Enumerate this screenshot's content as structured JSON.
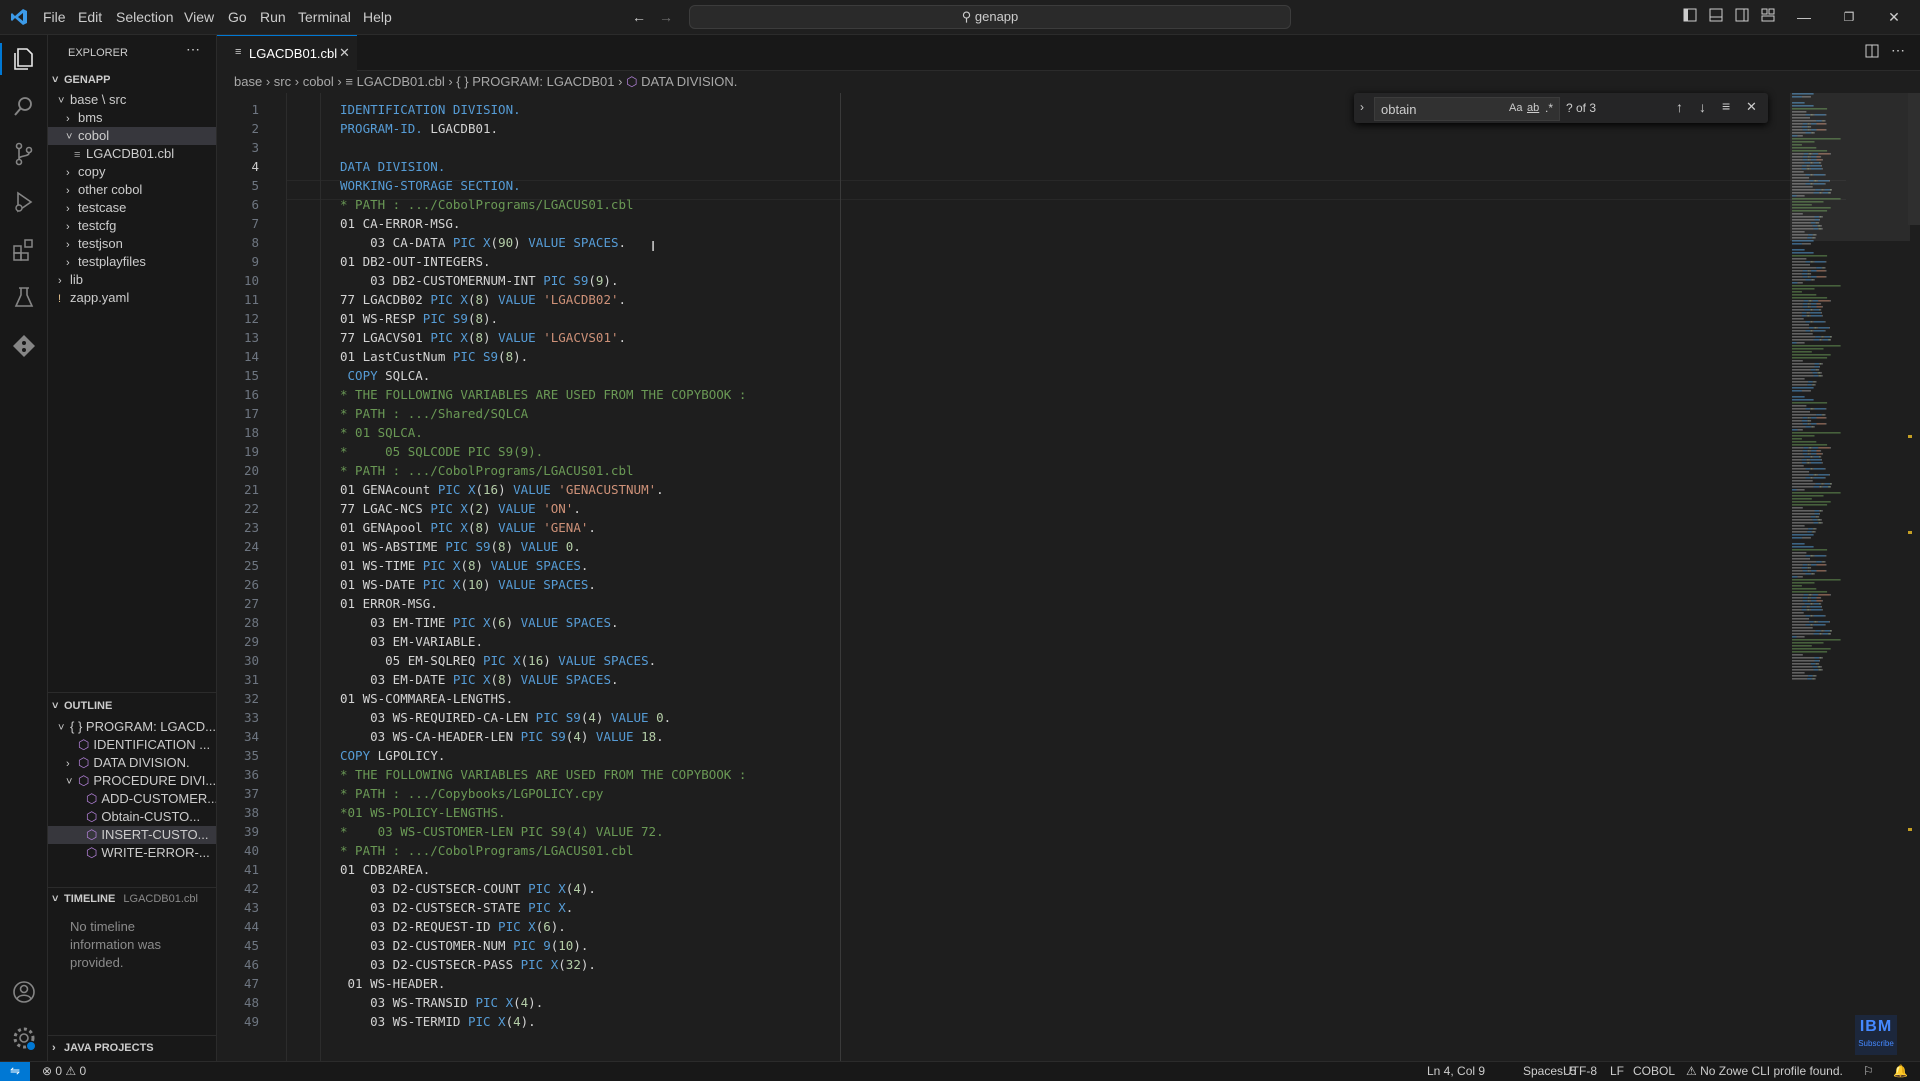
{
  "menu": [
    "File",
    "Edit",
    "Selection",
    "View",
    "Go",
    "Run",
    "Terminal",
    "Help"
  ],
  "command_center": "genapp",
  "sidebar": {
    "title": "EXPLORER",
    "root": "GENAPP",
    "tree": [
      {
        "label": "base \\ src",
        "indent": 1,
        "chev": "v"
      },
      {
        "label": "bms",
        "indent": 2,
        "chev": ">"
      },
      {
        "label": "cobol",
        "indent": 2,
        "chev": "v",
        "selected": true
      },
      {
        "label": "LGACDB01.cbl",
        "indent": 3,
        "chev": "",
        "icon": "file"
      },
      {
        "label": "copy",
        "indent": 2,
        "chev": ">"
      },
      {
        "label": "other cobol",
        "indent": 2,
        "chev": ">"
      },
      {
        "label": "testcase",
        "indent": 2,
        "chev": ">"
      },
      {
        "label": "testcfg",
        "indent": 2,
        "chev": ">"
      },
      {
        "label": "testjson",
        "indent": 2,
        "chev": ">"
      },
      {
        "label": "testplayfiles",
        "indent": 2,
        "chev": ">"
      },
      {
        "label": "lib",
        "indent": 1,
        "chev": ">"
      },
      {
        "label": "zapp.yaml",
        "indent": 1,
        "chev": "!",
        "icon": "yaml"
      }
    ],
    "outline": {
      "title": "OUTLINE",
      "items": [
        {
          "label": "{ } PROGRAM: LGACD...",
          "indent": 1,
          "chev": "v"
        },
        {
          "label": "IDENTIFICATION ...",
          "indent": 2,
          "chev": ""
        },
        {
          "label": "DATA DIVISION.",
          "indent": 2,
          "chev": ">"
        },
        {
          "label": "PROCEDURE DIVI...",
          "indent": 2,
          "chev": "v"
        },
        {
          "label": "ADD-CUSTOMER...",
          "indent": 3,
          "chev": ""
        },
        {
          "label": "Obtain-CUSTO...",
          "indent": 3,
          "chev": ""
        },
        {
          "label": "INSERT-CUSTO...",
          "indent": 3,
          "chev": "",
          "selected": true
        },
        {
          "label": "WRITE-ERROR-...",
          "indent": 3,
          "chev": ""
        }
      ]
    },
    "timeline": {
      "title": "TIMELINE",
      "file": "LGACDB01.cbl",
      "message": "No timeline information was provided."
    },
    "java_projects": "JAVA PROJECTS"
  },
  "tab": {
    "label": "LGACDB01.cbl"
  },
  "breadcrumb": [
    "base",
    "src",
    "cobol",
    "LGACDB01.cbl",
    "{ } PROGRAM: LGACDB01",
    "DATA DIVISION."
  ],
  "find": {
    "value": "obtain",
    "count": "? of 3",
    "match_case": "Aa",
    "whole_word": "ab",
    "regex": ".*"
  },
  "editor": {
    "current_line": 4,
    "lines": [
      [
        [
          "kw",
          "IDENTIFICATION DIVISION."
        ]
      ],
      [
        [
          "kw",
          "PROGRAM-ID."
        ],
        [
          "pl",
          " LGACDB01."
        ]
      ],
      [],
      [
        [
          "kw",
          "DATA DIVISION."
        ]
      ],
      [
        [
          "kw",
          "WORKING-STORAGE SECTION."
        ]
      ],
      [
        [
          "cm",
          "* PATH : .../CobolPrograms/LGACUS01.cbl"
        ]
      ],
      [
        [
          "pl",
          "01 CA-ERROR-MSG."
        ]
      ],
      [
        [
          "pl",
          "    03 CA-DATA "
        ],
        [
          "kw",
          "PIC X"
        ],
        [
          "pl",
          "("
        ],
        [
          "nm",
          "90"
        ],
        [
          "pl",
          ") "
        ],
        [
          "kw",
          "VALUE SPACES"
        ],
        [
          "pl",
          "."
        ]
      ],
      [
        [
          "pl",
          "01 DB2-OUT-INTEGERS."
        ]
      ],
      [
        [
          "pl",
          "    03 DB2-CUSTOMERNUM-INT "
        ],
        [
          "kw",
          "PIC S9"
        ],
        [
          "pl",
          "("
        ],
        [
          "nm",
          "9"
        ],
        [
          "pl",
          ")."
        ]
      ],
      [
        [
          "pl",
          "77 LGACDB02 "
        ],
        [
          "kw",
          "PIC X"
        ],
        [
          "pl",
          "("
        ],
        [
          "nm",
          "8"
        ],
        [
          "pl",
          ") "
        ],
        [
          "kw",
          "VALUE "
        ],
        [
          "st",
          "'LGACDB02'"
        ],
        [
          "pl",
          "."
        ]
      ],
      [
        [
          "pl",
          "01 WS-RESP "
        ],
        [
          "kw",
          "PIC S9"
        ],
        [
          "pl",
          "("
        ],
        [
          "nm",
          "8"
        ],
        [
          "pl",
          ")."
        ]
      ],
      [
        [
          "pl",
          "77 LGACVS01 "
        ],
        [
          "kw",
          "PIC X"
        ],
        [
          "pl",
          "("
        ],
        [
          "nm",
          "8"
        ],
        [
          "pl",
          ") "
        ],
        [
          "kw",
          "VALUE "
        ],
        [
          "st",
          "'LGACVS01'"
        ],
        [
          "pl",
          "."
        ]
      ],
      [
        [
          "pl",
          "01 LastCustNum "
        ],
        [
          "kw",
          "PIC S9"
        ],
        [
          "pl",
          "("
        ],
        [
          "nm",
          "8"
        ],
        [
          "pl",
          ")."
        ]
      ],
      [
        [
          "kw",
          " COPY "
        ],
        [
          "pl",
          "SQLCA."
        ]
      ],
      [
        [
          "cm",
          "* THE FOLLOWING VARIABLES ARE USED FROM THE COPYBOOK :"
        ]
      ],
      [
        [
          "cm",
          "* PATH : .../Shared/SQLCA"
        ]
      ],
      [
        [
          "cm",
          "* 01 SQLCA."
        ]
      ],
      [
        [
          "cm",
          "*     05 SQLCODE PIC S9(9)."
        ]
      ],
      [
        [
          "cm",
          "* PATH : .../CobolPrograms/LGACUS01.cbl"
        ]
      ],
      [
        [
          "pl",
          "01 GENAcount "
        ],
        [
          "kw",
          "PIC X"
        ],
        [
          "pl",
          "("
        ],
        [
          "nm",
          "16"
        ],
        [
          "pl",
          ") "
        ],
        [
          "kw",
          "VALUE "
        ],
        [
          "st",
          "'GENACUSTNUM'"
        ],
        [
          "pl",
          "."
        ]
      ],
      [
        [
          "pl",
          "77 LGAC-NCS "
        ],
        [
          "kw",
          "PIC X"
        ],
        [
          "pl",
          "("
        ],
        [
          "nm",
          "2"
        ],
        [
          "pl",
          ") "
        ],
        [
          "kw",
          "VALUE "
        ],
        [
          "st",
          "'ON'"
        ],
        [
          "pl",
          "."
        ]
      ],
      [
        [
          "pl",
          "01 GENApool "
        ],
        [
          "kw",
          "PIC X"
        ],
        [
          "pl",
          "("
        ],
        [
          "nm",
          "8"
        ],
        [
          "pl",
          ") "
        ],
        [
          "kw",
          "VALUE "
        ],
        [
          "st",
          "'GENA'"
        ],
        [
          "pl",
          "."
        ]
      ],
      [
        [
          "pl",
          "01 WS-ABSTIME "
        ],
        [
          "kw",
          "PIC S9"
        ],
        [
          "pl",
          "("
        ],
        [
          "nm",
          "8"
        ],
        [
          "pl",
          ") "
        ],
        [
          "kw",
          "VALUE "
        ],
        [
          "nm",
          "0"
        ],
        [
          "pl",
          "."
        ]
      ],
      [
        [
          "pl",
          "01 WS-TIME "
        ],
        [
          "kw",
          "PIC X"
        ],
        [
          "pl",
          "("
        ],
        [
          "nm",
          "8"
        ],
        [
          "pl",
          ") "
        ],
        [
          "kw",
          "VALUE SPACES"
        ],
        [
          "pl",
          "."
        ]
      ],
      [
        [
          "pl",
          "01 WS-DATE "
        ],
        [
          "kw",
          "PIC X"
        ],
        [
          "pl",
          "("
        ],
        [
          "nm",
          "10"
        ],
        [
          "pl",
          ") "
        ],
        [
          "kw",
          "VALUE SPACES"
        ],
        [
          "pl",
          "."
        ]
      ],
      [
        [
          "pl",
          "01 ERROR-MSG."
        ]
      ],
      [
        [
          "pl",
          "    03 EM-TIME "
        ],
        [
          "kw",
          "PIC X"
        ],
        [
          "pl",
          "("
        ],
        [
          "nm",
          "6"
        ],
        [
          "pl",
          ") "
        ],
        [
          "kw",
          "VALUE SPACES"
        ],
        [
          "pl",
          "."
        ]
      ],
      [
        [
          "pl",
          "    03 EM-VARIABLE."
        ]
      ],
      [
        [
          "pl",
          "      05 EM-SQLREQ "
        ],
        [
          "kw",
          "PIC X"
        ],
        [
          "pl",
          "("
        ],
        [
          "nm",
          "16"
        ],
        [
          "pl",
          ") "
        ],
        [
          "kw",
          "VALUE SPACES"
        ],
        [
          "pl",
          "."
        ]
      ],
      [
        [
          "pl",
          "    03 EM-DATE "
        ],
        [
          "kw",
          "PIC X"
        ],
        [
          "pl",
          "("
        ],
        [
          "nm",
          "8"
        ],
        [
          "pl",
          ") "
        ],
        [
          "kw",
          "VALUE SPACES"
        ],
        [
          "pl",
          "."
        ]
      ],
      [
        [
          "pl",
          "01 WS-COMMAREA-LENGTHS."
        ]
      ],
      [
        [
          "pl",
          "    03 WS-REQUIRED-CA-LEN "
        ],
        [
          "kw",
          "PIC S9"
        ],
        [
          "pl",
          "("
        ],
        [
          "nm",
          "4"
        ],
        [
          "pl",
          ") "
        ],
        [
          "kw",
          "VALUE "
        ],
        [
          "nm",
          "0"
        ],
        [
          "pl",
          "."
        ]
      ],
      [
        [
          "pl",
          "    03 WS-CA-HEADER-LEN "
        ],
        [
          "kw",
          "PIC S9"
        ],
        [
          "pl",
          "("
        ],
        [
          "nm",
          "4"
        ],
        [
          "pl",
          ") "
        ],
        [
          "kw",
          "VALUE "
        ],
        [
          "nm",
          "18"
        ],
        [
          "pl",
          "."
        ]
      ],
      [
        [
          "kw",
          "COPY "
        ],
        [
          "pl",
          "LGPOLICY."
        ]
      ],
      [
        [
          "cm",
          "* THE FOLLOWING VARIABLES ARE USED FROM THE COPYBOOK :"
        ]
      ],
      [
        [
          "cm",
          "* PATH : .../Copybooks/LGPOLICY.cpy"
        ]
      ],
      [
        [
          "cm",
          "*01 WS-POLICY-LENGTHS."
        ]
      ],
      [
        [
          "cm",
          "*    03 WS-CUSTOMER-LEN PIC S9(4) VALUE 72."
        ]
      ],
      [
        [
          "cm",
          "* PATH : .../CobolPrograms/LGACUS01.cbl"
        ]
      ],
      [
        [
          "pl",
          "01 CDB2AREA."
        ]
      ],
      [
        [
          "pl",
          "    03 D2-CUSTSECR-COUNT "
        ],
        [
          "kw",
          "PIC X"
        ],
        [
          "pl",
          "("
        ],
        [
          "nm",
          "4"
        ],
        [
          "pl",
          ")."
        ]
      ],
      [
        [
          "pl",
          "    03 D2-CUSTSECR-STATE "
        ],
        [
          "kw",
          "PIC X"
        ],
        [
          "pl",
          "."
        ]
      ],
      [
        [
          "pl",
          "    03 D2-REQUEST-ID "
        ],
        [
          "kw",
          "PIC X"
        ],
        [
          "pl",
          "("
        ],
        [
          "nm",
          "6"
        ],
        [
          "pl",
          ")."
        ]
      ],
      [
        [
          "pl",
          "    03 D2-CUSTOMER-NUM "
        ],
        [
          "kw",
          "PIC 9"
        ],
        [
          "pl",
          "("
        ],
        [
          "nm",
          "10"
        ],
        [
          "pl",
          ")."
        ]
      ],
      [
        [
          "pl",
          "    03 D2-CUSTSECR-PASS "
        ],
        [
          "kw",
          "PIC X"
        ],
        [
          "pl",
          "("
        ],
        [
          "nm",
          "32"
        ],
        [
          "pl",
          ")."
        ]
      ],
      [
        [
          "pl",
          " 01 WS-HEADER."
        ]
      ],
      [
        [
          "pl",
          "    03 WS-TRANSID "
        ],
        [
          "kw",
          "PIC X"
        ],
        [
          "pl",
          "("
        ],
        [
          "nm",
          "4"
        ],
        [
          "pl",
          ")."
        ]
      ],
      [
        [
          "pl",
          "    03 WS-TERMID "
        ],
        [
          "kw",
          "PIC X"
        ],
        [
          "pl",
          "("
        ],
        [
          "nm",
          "4"
        ],
        [
          "pl",
          ")."
        ]
      ]
    ]
  },
  "status": {
    "errors": "0",
    "warnings": "0",
    "cursor": "Ln 4, Col 9",
    "spaces": "Spaces: 5",
    "encoding": "UTF-8",
    "eol": "LF",
    "language": "COBOL",
    "zowe": "No Zowe CLI profile found."
  },
  "watermark": {
    "logo": "IBM",
    "sub": "Subscribe"
  },
  "colors": {
    "accent": "#0078d4",
    "keyword": "#569cd6",
    "string": "#ce9178",
    "comment": "#6a9955",
    "number": "#b5cea8"
  }
}
